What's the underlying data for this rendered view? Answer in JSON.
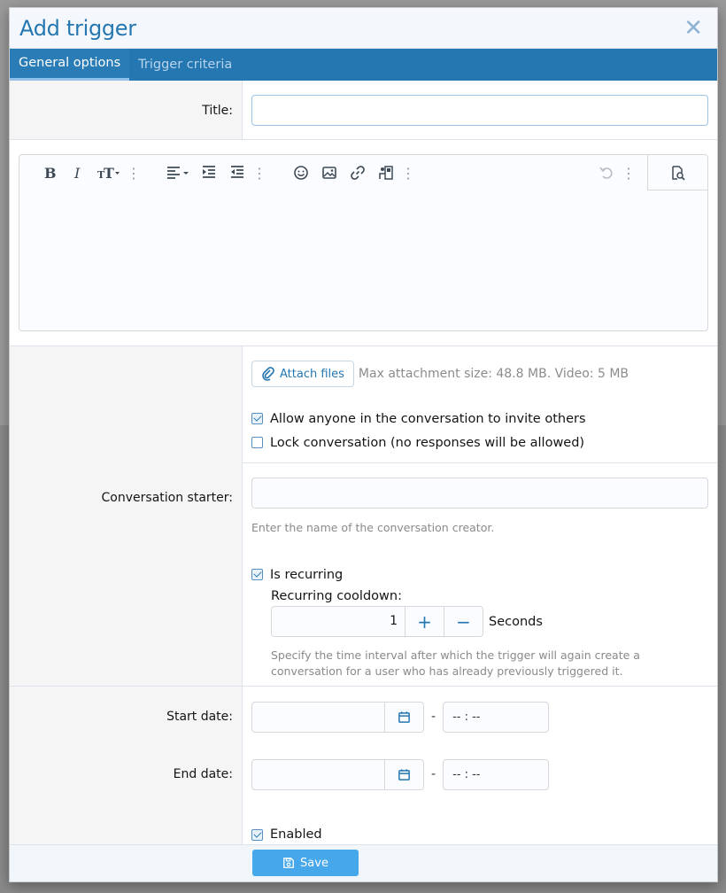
{
  "dialog": {
    "title": "Add trigger",
    "close_glyph": "✕"
  },
  "tabs": [
    {
      "label": "General options",
      "active": true
    },
    {
      "label": "Trigger criteria",
      "active": false
    }
  ],
  "fields": {
    "title_label": "Title:",
    "title_value": "",
    "conversation_starter_label": "Conversation starter:",
    "conversation_starter_value": "",
    "conversation_starter_hint": "Enter the name of the conversation creator.",
    "start_date_label": "Start date:",
    "end_date_label": "End date:",
    "start_time_placeholder": "-- : --",
    "end_time_placeholder": "-- : --",
    "date_separator": "-"
  },
  "attachments": {
    "button_label": "Attach files",
    "info": "Max attachment size: 48.8 MB. Video: 5 MB"
  },
  "options": {
    "allow_invite": {
      "label": "Allow anyone in the conversation to invite others",
      "checked": true
    },
    "lock_conversation": {
      "label": "Lock conversation (no responses will be allowed)",
      "checked": false
    },
    "is_recurring": {
      "label": "Is recurring",
      "checked": true
    },
    "enabled": {
      "label": "Enabled",
      "checked": true
    }
  },
  "recurring": {
    "label": "Recurring cooldown:",
    "value": "1",
    "unit": "Seconds",
    "plus": "+",
    "minus": "−",
    "hint": "Specify the time interval after which the trigger will again create a conversation for a user who has already previously triggered it."
  },
  "footer": {
    "save_label": "Save"
  },
  "icons": {
    "bold": "bold-icon",
    "italic": "italic-icon",
    "text_size": "text-size-icon",
    "align": "align-left-icon",
    "indent": "indent-icon",
    "outdent": "outdent-icon",
    "emoji": "smile-icon",
    "image": "image-icon",
    "link": "link-icon",
    "media": "media-icon",
    "undo": "undo-icon",
    "preview": "preview-icon",
    "paperclip": "paperclip-icon",
    "calendar": "calendar-icon",
    "save": "floppy-icon"
  },
  "colors": {
    "accent": "#2577b1",
    "save_button": "#47a7eb"
  }
}
